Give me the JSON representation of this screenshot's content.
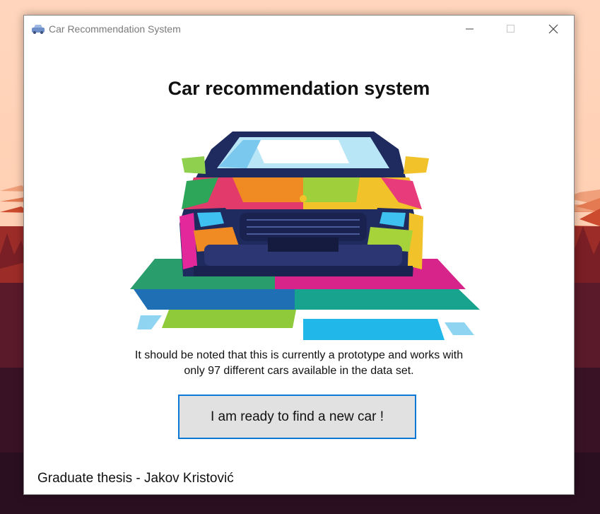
{
  "window": {
    "title": "Car Recommendation System"
  },
  "main": {
    "heading": "Car recommendation system",
    "note_line1": "It should be noted that this is currently a prototype and works with",
    "note_line2": "only 97 different cars available in the data set.",
    "ready_button_label": "I am ready to find a new car !",
    "footer": "Graduate thesis - Jakov Kristović"
  },
  "colors": {
    "button_border": "#0b78d7",
    "button_bg": "#e1e1e1",
    "wallpaper_sky": "#ffd7c0",
    "wallpaper_mountains": "#c9472a"
  },
  "icons": [
    "car-app-icon",
    "minimize-icon",
    "maximize-icon",
    "close-icon"
  ]
}
